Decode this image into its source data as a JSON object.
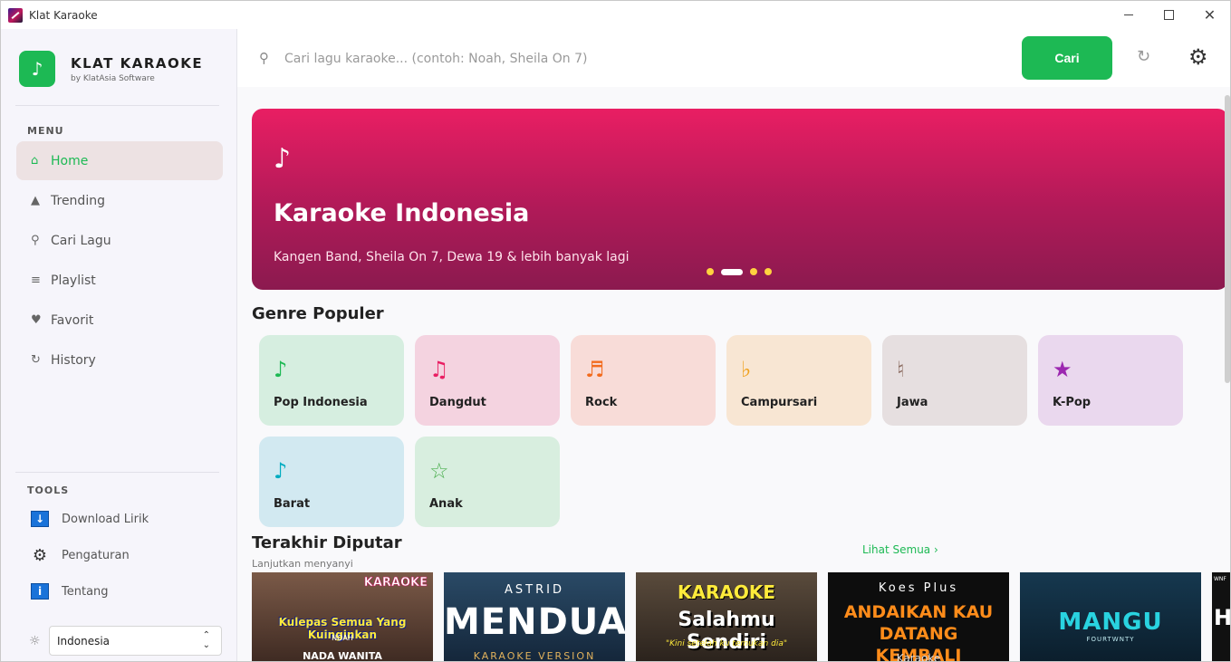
{
  "window": {
    "title": "Klat Karaoke",
    "close_glyph": "✕"
  },
  "brand": {
    "logo_glyph": "♪",
    "name": "KLAT KARAOKE",
    "subtitle": "by KlatAsia Software"
  },
  "sidebar": {
    "menu_label": "MENU",
    "items": [
      {
        "label": "Home",
        "icon": "home-icon",
        "glyph": "⌂",
        "active": true
      },
      {
        "label": "Trending",
        "icon": "trending-icon",
        "glyph": "▲",
        "active": false
      },
      {
        "label": "Cari Lagu",
        "icon": "search-icon",
        "glyph": "⚲",
        "active": false
      },
      {
        "label": "Playlist",
        "icon": "list-icon",
        "glyph": "≡",
        "active": false
      },
      {
        "label": "Favorit",
        "icon": "heart-icon",
        "glyph": "♥",
        "active": false
      },
      {
        "label": "History",
        "icon": "history-icon",
        "glyph": "↻",
        "active": false
      }
    ],
    "tools_label": "TOOLS",
    "tools": [
      {
        "label": "Download Lirik",
        "icon": "download-icon",
        "glyph": "↓"
      },
      {
        "label": "Pengaturan",
        "icon": "gear-icon",
        "glyph": "⚙"
      },
      {
        "label": "Tentang",
        "icon": "info-icon",
        "glyph": "i"
      }
    ],
    "theme_glyph": "☼",
    "region": {
      "selected": "Indonesia",
      "arrow_up": "⌃",
      "arrow_down": "⌄"
    }
  },
  "topbar": {
    "search_glyph": "⚲",
    "search_placeholder": "Cari lagu karaoke... (contoh: Noah, Sheila On 7)",
    "search_value": "",
    "search_button": "Cari",
    "refresh_glyph": "↻",
    "settings_glyph": "⚙"
  },
  "banner": {
    "icon_glyph": "♪",
    "title": "Karaoke Indonesia",
    "subtitle": "Kangen Band, Sheila On 7, Dewa 19 & lebih banyak lagi",
    "slide_count": 4,
    "active_slide": 1
  },
  "genres": {
    "title": "Genre Populer",
    "items": [
      {
        "label": "Pop Indonesia",
        "icon": "music-note-icon",
        "glyph": "♪",
        "color": "#1db954",
        "bg": "#d6eee0"
      },
      {
        "label": "Dangdut",
        "icon": "music-notes-icon",
        "glyph": "♫",
        "color": "#e91e63",
        "bg": "#f4d3e0"
      },
      {
        "label": "Rock",
        "icon": "music-notes-icon",
        "glyph": "♬",
        "color": "#f26b1d",
        "bg": "#f8dcd8"
      },
      {
        "label": "Campursari",
        "icon": "flat-icon",
        "glyph": "♭",
        "color": "#f0a11e",
        "bg": "#f8e6d3"
      },
      {
        "label": "Jawa",
        "icon": "natural-icon",
        "glyph": "♮",
        "color": "#8d6e63",
        "bg": "#e6dfe0"
      },
      {
        "label": "K-Pop",
        "icon": "star-icon",
        "glyph": "★",
        "color": "#9c27b0",
        "bg": "#ead8ee"
      },
      {
        "label": "Barat",
        "icon": "music-note-icon",
        "glyph": "♪",
        "color": "#00acc1",
        "bg": "#d2e9f1"
      },
      {
        "label": "Anak",
        "icon": "star-outline-icon",
        "glyph": "☆",
        "color": "#4caf50",
        "bg": "#d8eedf"
      }
    ]
  },
  "recent": {
    "title": "Terakhir Diputar",
    "subtitle": "Lanjutkan menyanyi",
    "see_all": "Lihat Semua ›",
    "thumbnails": [
      {
        "top": "KARAOKE",
        "main": "Kulepas Semua Yang Kuinginkan",
        "small": "NOAH",
        "bottom": "NADA WANITA",
        "bg": "#6b4a3a"
      },
      {
        "top": "ASTRID",
        "main": "MENDUA",
        "small": "",
        "bottom": "KARAOKE VERSION",
        "bg": "#1d3a55"
      },
      {
        "top": "KARAOKE",
        "main": "Salahmu Sendiri",
        "small": "\"Kini setelah ku temukan dia\"",
        "bottom": "",
        "bg": "#4a4036"
      },
      {
        "top": "Koes Plus",
        "main": "ANDAIKAN KAU DATANG KEMBALI",
        "small": "",
        "bottom": "Karaoke",
        "bg": "#0d0d0d"
      },
      {
        "top": "",
        "main": "MANGU",
        "small": "FOURTWNTY",
        "bottom": "",
        "bg": "#112f42"
      },
      {
        "top": "WNF",
        "main": "H",
        "small": "",
        "bottom": "",
        "bg": "#111111"
      }
    ]
  }
}
